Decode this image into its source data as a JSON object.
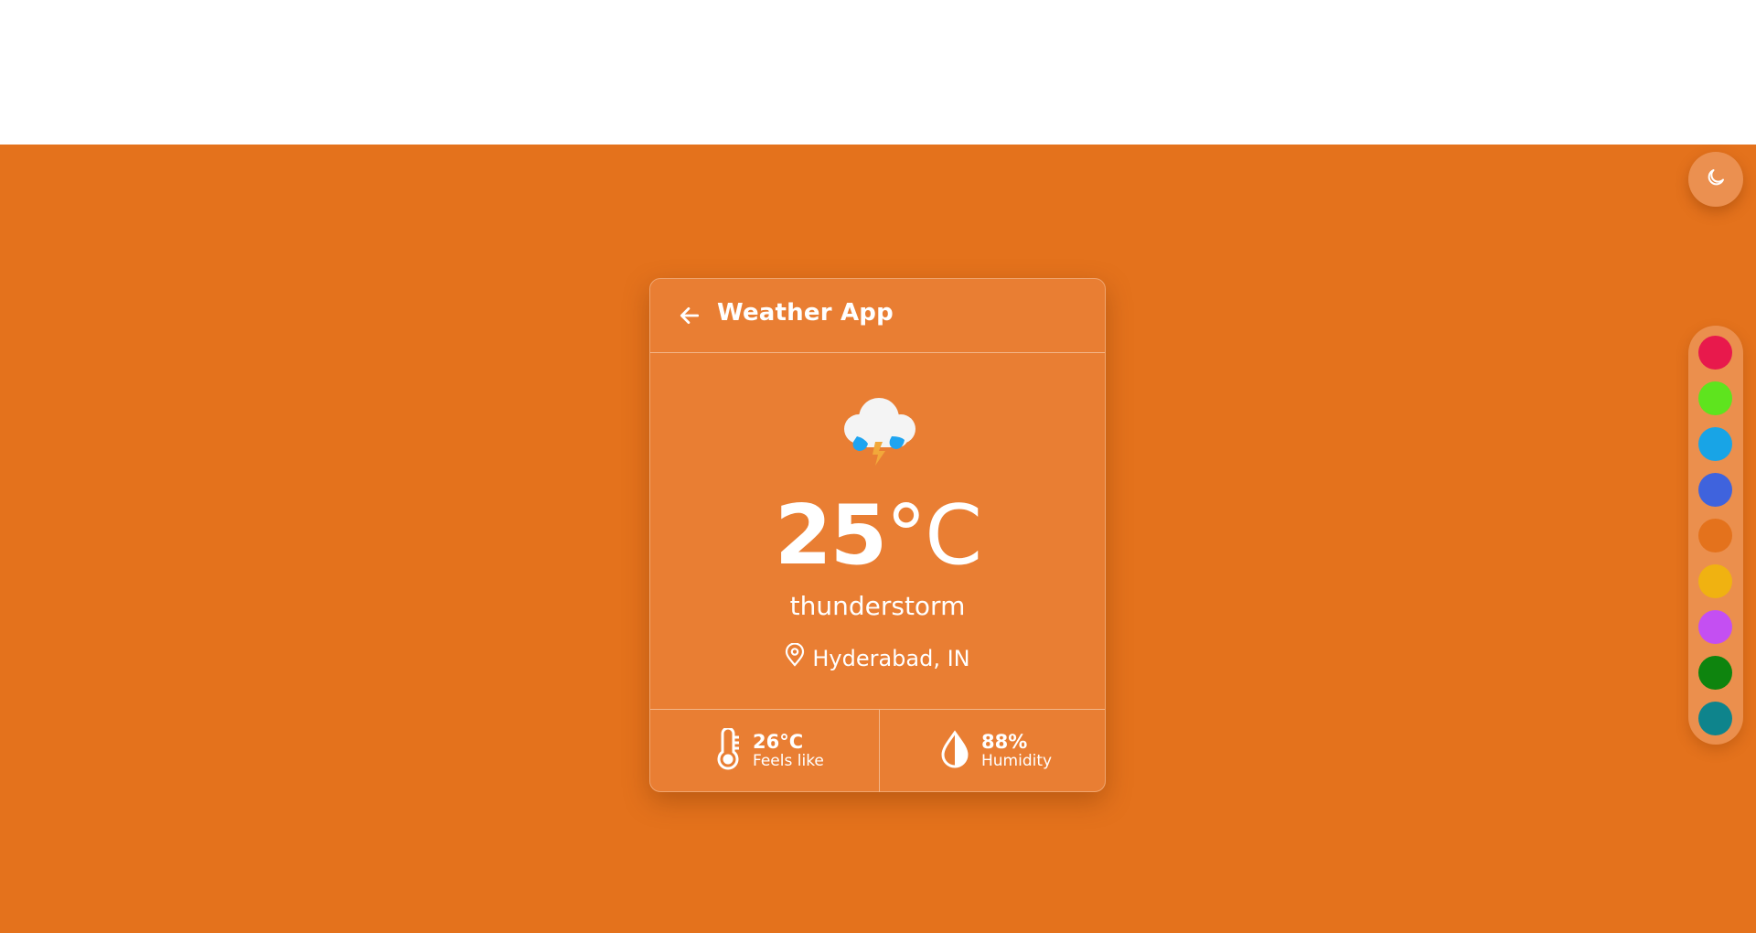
{
  "header": {
    "title": "Weather App",
    "back_icon": "arrow-left-icon"
  },
  "weather": {
    "icon": "thunderstorm-cloud-icon",
    "temperature_value": "25",
    "temperature_unit": "°C",
    "condition": "thunderstorm",
    "location": "Hyderabad, IN",
    "location_icon": "map-pin-icon"
  },
  "stats": {
    "feels_like": {
      "icon": "thermometer-icon",
      "value": "26°C",
      "label": "Feels like"
    },
    "humidity": {
      "icon": "droplet-icon",
      "value": "88%",
      "label": "Humidity"
    }
  },
  "theme_toggle": {
    "icon": "moon-icon"
  },
  "palette": {
    "colors": [
      "#e8194c",
      "#5ee41e",
      "#18a4e6",
      "#3f63dd",
      "#e4721c",
      "#f0b211",
      "#c44ff2",
      "#0e840e",
      "#0e848c"
    ],
    "selected": "#e4721c"
  },
  "colors": {
    "background": "#e4721c",
    "card": "#e97e33"
  }
}
